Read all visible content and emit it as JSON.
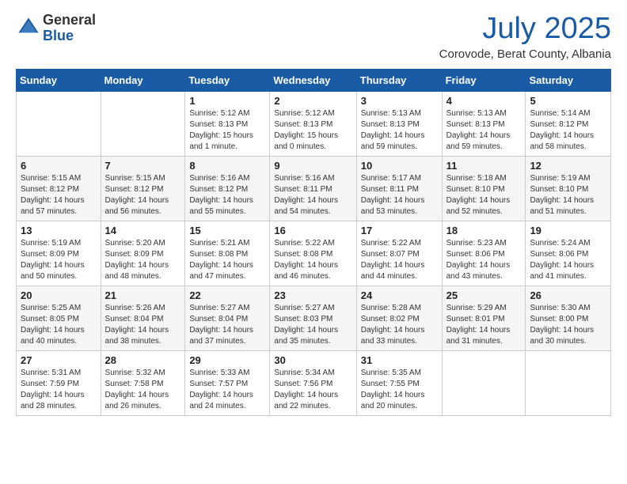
{
  "logo": {
    "general": "General",
    "blue": "Blue"
  },
  "title": "July 2025",
  "subtitle": "Corovode, Berat County, Albania",
  "days_of_week": [
    "Sunday",
    "Monday",
    "Tuesday",
    "Wednesday",
    "Thursday",
    "Friday",
    "Saturday"
  ],
  "weeks": [
    [
      {
        "day": "",
        "info": ""
      },
      {
        "day": "",
        "info": ""
      },
      {
        "day": "1",
        "info": "Sunrise: 5:12 AM\nSunset: 8:13 PM\nDaylight: 15 hours and 1 minute."
      },
      {
        "day": "2",
        "info": "Sunrise: 5:12 AM\nSunset: 8:13 PM\nDaylight: 15 hours and 0 minutes."
      },
      {
        "day": "3",
        "info": "Sunrise: 5:13 AM\nSunset: 8:13 PM\nDaylight: 14 hours and 59 minutes."
      },
      {
        "day": "4",
        "info": "Sunrise: 5:13 AM\nSunset: 8:13 PM\nDaylight: 14 hours and 59 minutes."
      },
      {
        "day": "5",
        "info": "Sunrise: 5:14 AM\nSunset: 8:12 PM\nDaylight: 14 hours and 58 minutes."
      }
    ],
    [
      {
        "day": "6",
        "info": "Sunrise: 5:15 AM\nSunset: 8:12 PM\nDaylight: 14 hours and 57 minutes."
      },
      {
        "day": "7",
        "info": "Sunrise: 5:15 AM\nSunset: 8:12 PM\nDaylight: 14 hours and 56 minutes."
      },
      {
        "day": "8",
        "info": "Sunrise: 5:16 AM\nSunset: 8:12 PM\nDaylight: 14 hours and 55 minutes."
      },
      {
        "day": "9",
        "info": "Sunrise: 5:16 AM\nSunset: 8:11 PM\nDaylight: 14 hours and 54 minutes."
      },
      {
        "day": "10",
        "info": "Sunrise: 5:17 AM\nSunset: 8:11 PM\nDaylight: 14 hours and 53 minutes."
      },
      {
        "day": "11",
        "info": "Sunrise: 5:18 AM\nSunset: 8:10 PM\nDaylight: 14 hours and 52 minutes."
      },
      {
        "day": "12",
        "info": "Sunrise: 5:19 AM\nSunset: 8:10 PM\nDaylight: 14 hours and 51 minutes."
      }
    ],
    [
      {
        "day": "13",
        "info": "Sunrise: 5:19 AM\nSunset: 8:09 PM\nDaylight: 14 hours and 50 minutes."
      },
      {
        "day": "14",
        "info": "Sunrise: 5:20 AM\nSunset: 8:09 PM\nDaylight: 14 hours and 48 minutes."
      },
      {
        "day": "15",
        "info": "Sunrise: 5:21 AM\nSunset: 8:08 PM\nDaylight: 14 hours and 47 minutes."
      },
      {
        "day": "16",
        "info": "Sunrise: 5:22 AM\nSunset: 8:08 PM\nDaylight: 14 hours and 46 minutes."
      },
      {
        "day": "17",
        "info": "Sunrise: 5:22 AM\nSunset: 8:07 PM\nDaylight: 14 hours and 44 minutes."
      },
      {
        "day": "18",
        "info": "Sunrise: 5:23 AM\nSunset: 8:06 PM\nDaylight: 14 hours and 43 minutes."
      },
      {
        "day": "19",
        "info": "Sunrise: 5:24 AM\nSunset: 8:06 PM\nDaylight: 14 hours and 41 minutes."
      }
    ],
    [
      {
        "day": "20",
        "info": "Sunrise: 5:25 AM\nSunset: 8:05 PM\nDaylight: 14 hours and 40 minutes."
      },
      {
        "day": "21",
        "info": "Sunrise: 5:26 AM\nSunset: 8:04 PM\nDaylight: 14 hours and 38 minutes."
      },
      {
        "day": "22",
        "info": "Sunrise: 5:27 AM\nSunset: 8:04 PM\nDaylight: 14 hours and 37 minutes."
      },
      {
        "day": "23",
        "info": "Sunrise: 5:27 AM\nSunset: 8:03 PM\nDaylight: 14 hours and 35 minutes."
      },
      {
        "day": "24",
        "info": "Sunrise: 5:28 AM\nSunset: 8:02 PM\nDaylight: 14 hours and 33 minutes."
      },
      {
        "day": "25",
        "info": "Sunrise: 5:29 AM\nSunset: 8:01 PM\nDaylight: 14 hours and 31 minutes."
      },
      {
        "day": "26",
        "info": "Sunrise: 5:30 AM\nSunset: 8:00 PM\nDaylight: 14 hours and 30 minutes."
      }
    ],
    [
      {
        "day": "27",
        "info": "Sunrise: 5:31 AM\nSunset: 7:59 PM\nDaylight: 14 hours and 28 minutes."
      },
      {
        "day": "28",
        "info": "Sunrise: 5:32 AM\nSunset: 7:58 PM\nDaylight: 14 hours and 26 minutes."
      },
      {
        "day": "29",
        "info": "Sunrise: 5:33 AM\nSunset: 7:57 PM\nDaylight: 14 hours and 24 minutes."
      },
      {
        "day": "30",
        "info": "Sunrise: 5:34 AM\nSunset: 7:56 PM\nDaylight: 14 hours and 22 minutes."
      },
      {
        "day": "31",
        "info": "Sunrise: 5:35 AM\nSunset: 7:55 PM\nDaylight: 14 hours and 20 minutes."
      },
      {
        "day": "",
        "info": ""
      },
      {
        "day": "",
        "info": ""
      }
    ]
  ]
}
